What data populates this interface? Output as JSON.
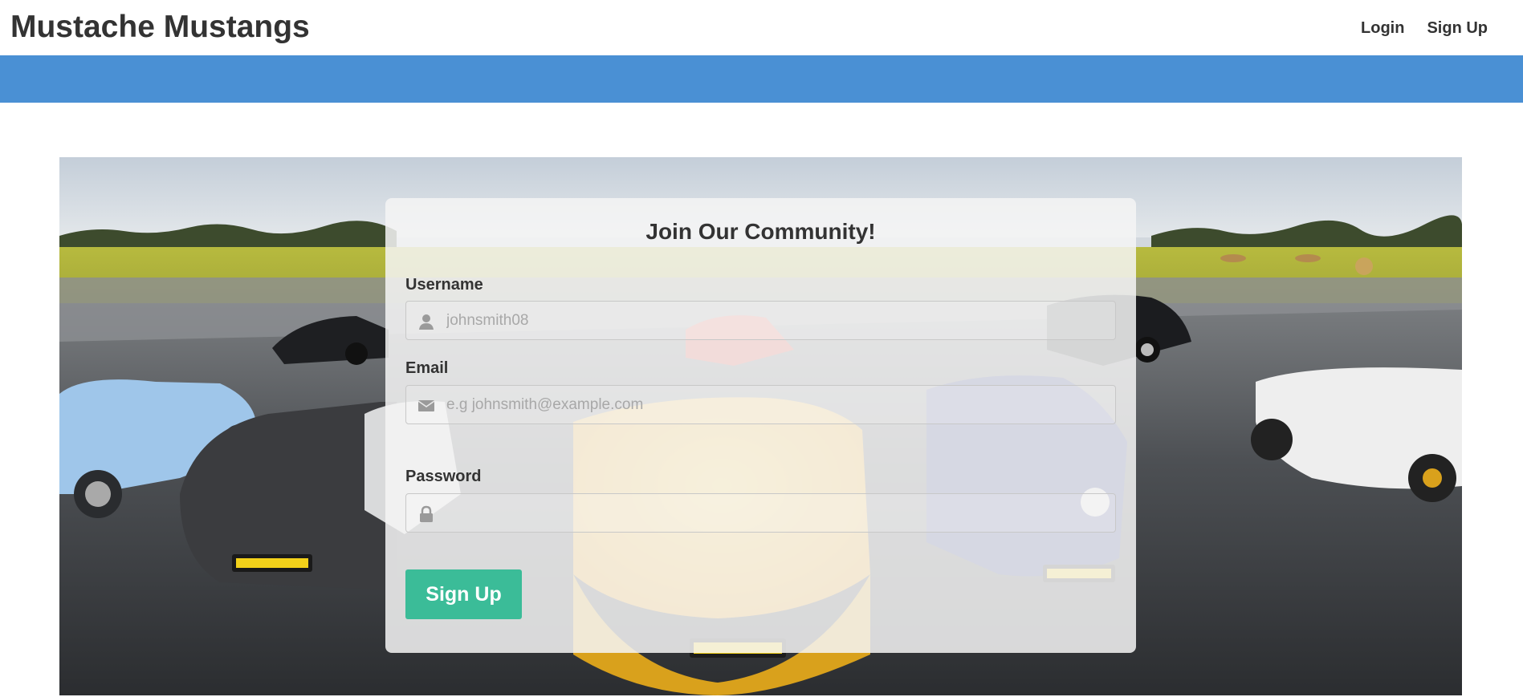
{
  "header": {
    "brand": "Mustache Mustangs",
    "nav": [
      {
        "label": "Login"
      },
      {
        "label": "Sign Up"
      }
    ]
  },
  "colors": {
    "accent_bar": "#4a90d4",
    "submit_button": "#3bbc98"
  },
  "hero": {
    "image": "runway-with-sports-cars-photo"
  },
  "form": {
    "title": "Join Our Community!",
    "username": {
      "label": "Username",
      "placeholder": "johnsmith08",
      "value": "",
      "icon": "user-icon"
    },
    "email": {
      "label": "Email",
      "placeholder": "e.g johnsmith@example.com",
      "value": "",
      "icon": "envelope-icon"
    },
    "password": {
      "label": "Password",
      "placeholder": "",
      "value": "",
      "icon": "lock-icon"
    },
    "submit_label": "Sign Up"
  }
}
